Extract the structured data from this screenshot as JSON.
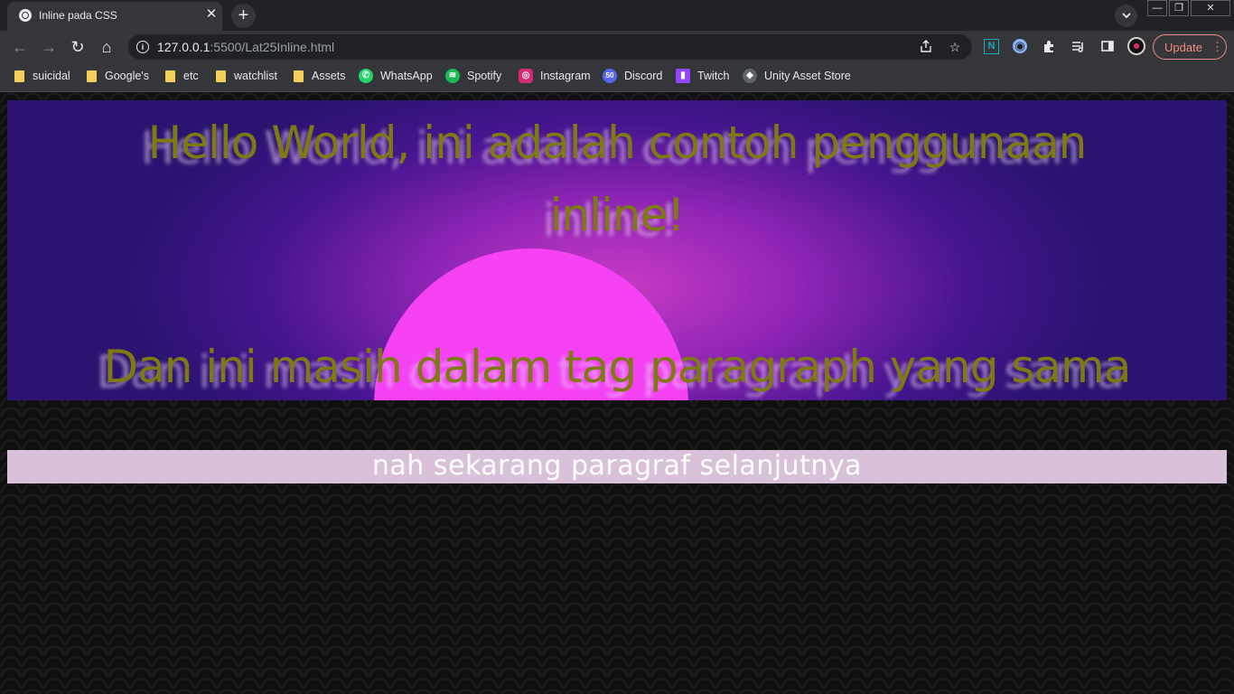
{
  "tab": {
    "title": "Inline pada CSS",
    "close_glyph": "✕"
  },
  "new_tab_glyph": "+",
  "window_controls": {
    "minimize": "—",
    "restore": "❐",
    "close": "✕"
  },
  "nav": {
    "back": "←",
    "forward": "→",
    "reload": "↻",
    "home": "⌂"
  },
  "address": {
    "host": "127.0.0.1",
    "rest": ":5500/Lat25Inline.html"
  },
  "update_button": {
    "label": "Update"
  },
  "bookmarks": [
    {
      "label": "suicidal",
      "icon": "folder-icon"
    },
    {
      "label": "Google's",
      "icon": "folder-icon"
    },
    {
      "label": "etc",
      "icon": "folder-icon"
    },
    {
      "label": "watchlist",
      "icon": "folder-icon"
    },
    {
      "label": "Assets",
      "icon": "folder-icon"
    },
    {
      "label": "WhatsApp",
      "icon": "whatsapp-icon",
      "color": "#25d366"
    },
    {
      "label": "Spotify",
      "icon": "spotify-icon",
      "color": "#1db954"
    },
    {
      "label": "Instagram",
      "icon": "instagram-icon",
      "color": "#d62976"
    },
    {
      "label": "Discord",
      "icon": "discord-icon",
      "color": "#5865f2",
      "badge": "50"
    },
    {
      "label": "Twitch",
      "icon": "twitch-icon",
      "color": "#9146ff"
    },
    {
      "label": "Unity Asset Store",
      "icon": "unity-icon",
      "color": "#bdc1c6"
    }
  ],
  "page": {
    "paragraph1_line1": "Hello World, ini adalah contoh penggunaan",
    "paragraph1_line2": "inline!",
    "paragraph1_line3": "Dan ini masih dalam tag paragraph yang sama",
    "paragraph2": "nah sekarang paragraf selanjutnya"
  },
  "colors": {
    "hero_text": "#7d7a10",
    "para2_bg": "#d9c1d9",
    "sun": "#f542f5"
  }
}
